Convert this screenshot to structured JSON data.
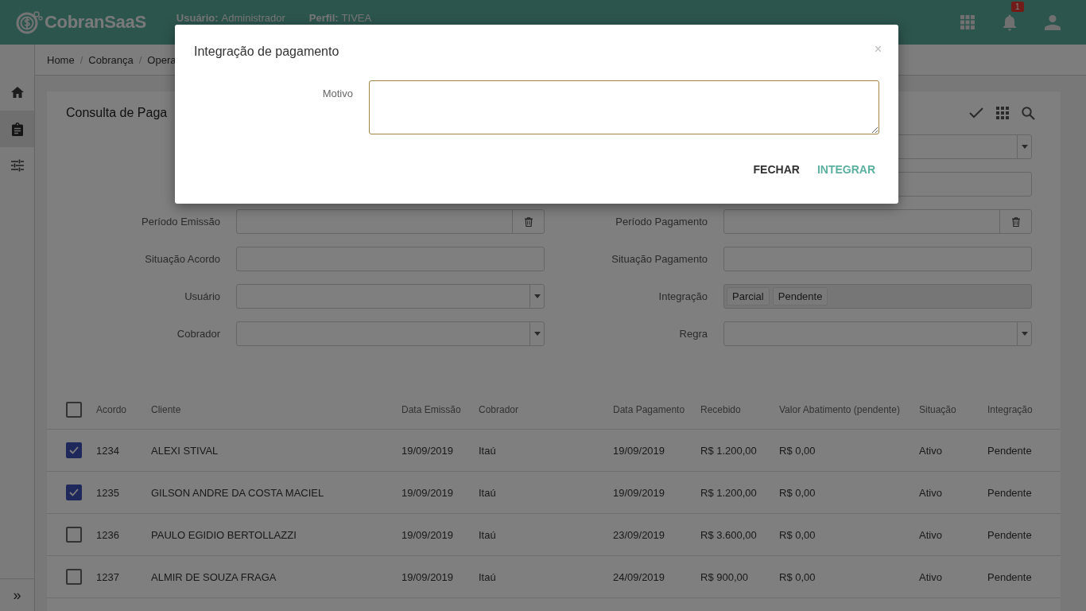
{
  "topbar": {
    "logo": "CobranSaaS",
    "user_label": "Usuário:",
    "user": "Administrador",
    "profile_label": "Perfil:",
    "profile": "TIVEA",
    "notification_count": "1"
  },
  "sidebar": {
    "items": [
      {
        "selected": false
      },
      {
        "selected": true
      },
      {
        "selected": false
      }
    ],
    "expand": "»"
  },
  "breadcrumb": {
    "separator": "/",
    "items": [
      "Home",
      "Cobrança",
      "Opera"
    ]
  },
  "card": {
    "title": "Consulta de Paga"
  },
  "filters": [
    {
      "right": {
        "kind": "select"
      }
    },
    {
      "right": {
        "kind": "text"
      }
    },
    {
      "left": {
        "label": "Período Emissão",
        "kind": "date"
      },
      "right": {
        "label": "Período Pagamento",
        "kind": "date"
      }
    },
    {
      "left": {
        "label": "Situação Acordo",
        "kind": "text"
      },
      "right": {
        "label": "Situação Pagamento",
        "kind": "text"
      }
    },
    {
      "left": {
        "label": "Usuário",
        "kind": "select"
      },
      "right": {
        "label": "Integração",
        "kind": "tags",
        "tags": [
          "Parcial",
          "Pendente"
        ]
      }
    },
    {
      "left": {
        "label": "Cobrador",
        "kind": "select"
      },
      "right": {
        "label": "Regra",
        "kind": "select"
      }
    }
  ],
  "table": {
    "all_checked": false,
    "columns": [
      "Acordo",
      "Cliente",
      "Data Emissão",
      "Cobrador",
      "Data Pagamento",
      "Recebido",
      "Valor Abatimento (pendente)",
      "Situação",
      "Integração"
    ],
    "rows": [
      {
        "selected": true,
        "cells": [
          "1234",
          "ALEXI STIVAL",
          "19/09/2019",
          "Itaú",
          "19/09/2019",
          "R$ 1.200,00",
          "R$ 0,00",
          "Ativo",
          "Pendente"
        ]
      },
      {
        "selected": true,
        "cells": [
          "1235",
          "GILSON ANDRE DA COSTA MACIEL",
          "19/09/2019",
          "Itaú",
          "19/09/2019",
          "R$ 1.200,00",
          "R$ 0,00",
          "Ativo",
          "Pendente"
        ]
      },
      {
        "selected": false,
        "cells": [
          "1236",
          "PAULO EGIDIO BERTOLLAZZI",
          "19/09/2019",
          "Itaú",
          "23/09/2019",
          "R$ 3.600,00",
          "R$ 0,00",
          "Ativo",
          "Pendente"
        ]
      },
      {
        "selected": false,
        "cells": [
          "1237",
          "ALMIR DE SOUZA FRAGA",
          "19/09/2019",
          "Itaú",
          "24/09/2019",
          "R$ 900,00",
          "R$ 0,00",
          "Ativo",
          "Pendente"
        ]
      }
    ]
  },
  "modal": {
    "title": "Integração de pagamento",
    "close": "×",
    "field_label": "Motivo",
    "buttons": [
      {
        "label": "FECHAR",
        "kind": "secondary"
      },
      {
        "label": "INTEGRAR",
        "kind": "primary"
      }
    ]
  }
}
